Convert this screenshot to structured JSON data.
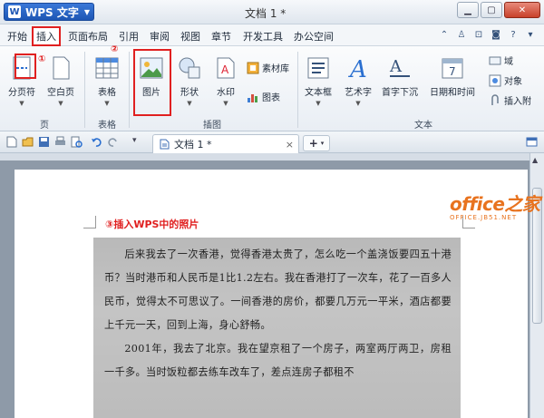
{
  "app": {
    "name": "WPS 文字",
    "logo": "W",
    "doc_title": "文档 1 *"
  },
  "menu": {
    "tabs": [
      "开始",
      "插入",
      "页面布局",
      "引用",
      "审阅",
      "视图",
      "章节",
      "开发工具",
      "办公空间"
    ],
    "active": "插入"
  },
  "ribbon": {
    "page_group": {
      "label": "页",
      "page_break": "分页符",
      "blank_page": "空白页"
    },
    "table_group": {
      "label": "表格",
      "table": "表格"
    },
    "illustration_group": {
      "label": "插图",
      "picture": "图片",
      "shape": "形状",
      "watermark": "水印",
      "material": "素材库",
      "chart": "图表"
    },
    "text_group": {
      "label": "文本",
      "textbox": "文本框",
      "wordart": "艺术字",
      "dropcap": "首字下沉",
      "datetime": "日期和时间",
      "field": "域",
      "object": "对象",
      "insert_attach": "插入附"
    }
  },
  "markers": {
    "one": "①",
    "two": "②"
  },
  "doc_tab": {
    "label": "文档 1 *",
    "close": "×",
    "new": "+"
  },
  "document": {
    "annotation": "③插入WPS中的照片",
    "paragraphs": [
      "后来我去了一次香港，觉得香港太贵了，怎么吃一个盖浇饭要四五十港币？当时港币和人民币是1比1.2左右。我在香港打了一次车，花了一百多人民币，觉得太不可思议了。一间香港的房价，都要几万元一平米，酒店都要上千元一天，回到上海，身心舒畅。",
      "2001年，我去了北京。我在望京租了一个房子，两室两厅两卫，房租一千多。当时饭粒都去练车改车了，差点连房子都租不"
    ]
  },
  "watermark": {
    "brand": "office之家",
    "url": "OFFICE.JB51.NET"
  },
  "colors": {
    "highlight": "#e02020",
    "accent": "#1d56b4",
    "brand": "#e8731f"
  }
}
